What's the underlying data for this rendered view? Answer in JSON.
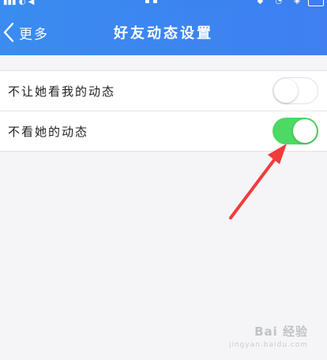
{
  "nav": {
    "back_label": "更多",
    "title": "好友动态设置"
  },
  "settings": [
    {
      "label": "不让她看我的动态",
      "enabled": false
    },
    {
      "label": "不看她的动态",
      "enabled": true
    }
  ],
  "colors": {
    "nav_bar": "#3c86f0",
    "switch_on": "#4cd964",
    "annotation_arrow": "#f03c3c"
  },
  "watermark": {
    "brand": "Bai 经验",
    "url": "jingyan.baidu.com"
  }
}
